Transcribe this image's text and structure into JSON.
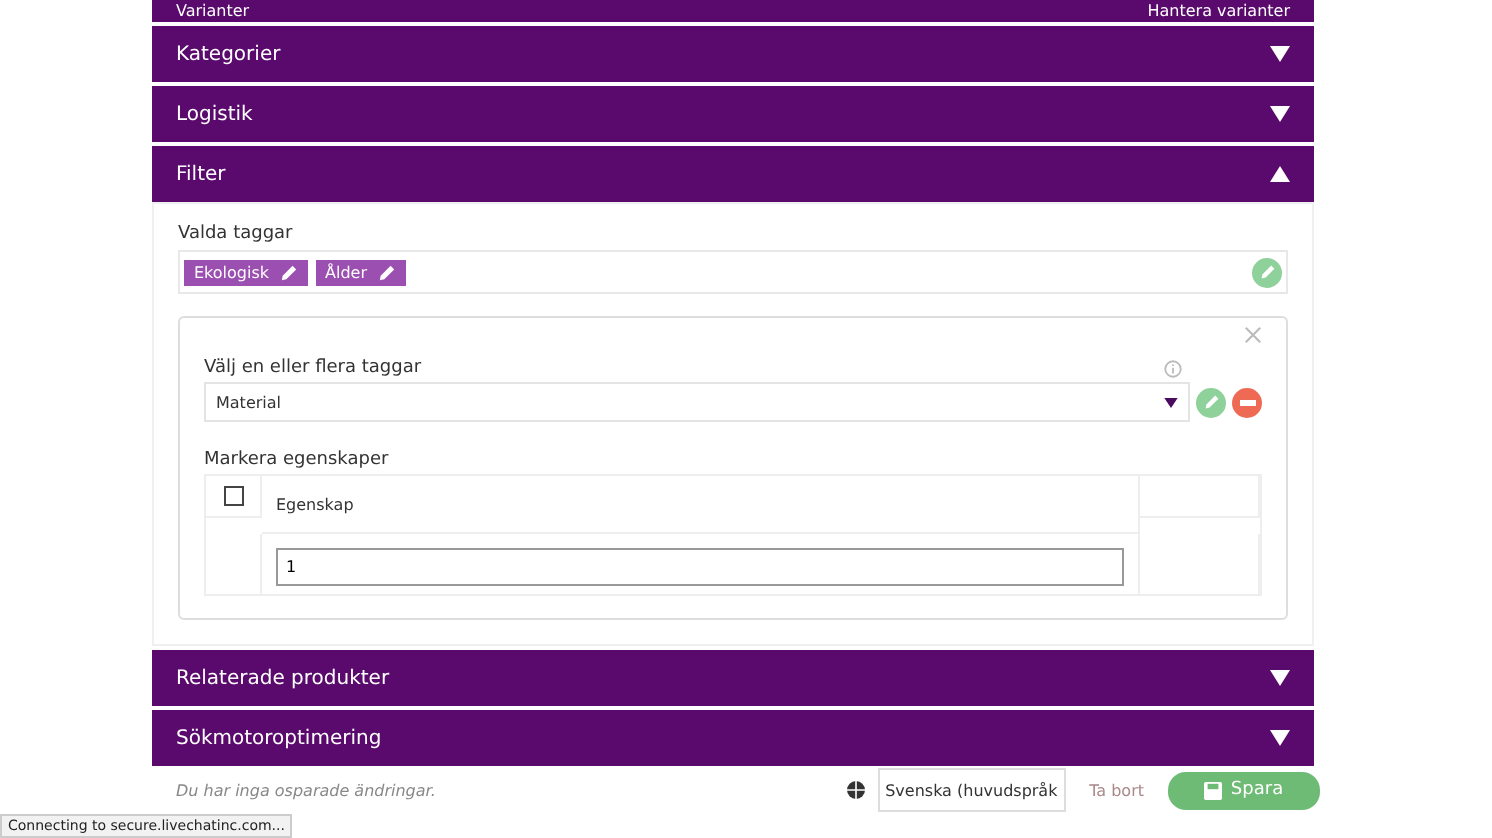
{
  "top_section": {
    "title": "Varianter",
    "action": "Hantera varianter"
  },
  "sections_before": [
    {
      "title": "Kategorier",
      "expanded": false
    },
    {
      "title": "Logistik",
      "expanded": false
    },
    {
      "title": "Filter",
      "expanded": true
    }
  ],
  "filter": {
    "selected_label": "Valda taggar",
    "tags": [
      "Ekologisk",
      "Ålder"
    ],
    "editor": {
      "select_label": "Välj en eller flera taggar",
      "select_value": "Material",
      "properties_label": "Markera egenskaper",
      "column_header": "Egenskap",
      "checked": false,
      "input_value": "1"
    }
  },
  "sections_after": [
    {
      "title": "Relaterade produkter",
      "expanded": false
    },
    {
      "title": "Sökmotoroptimering",
      "expanded": false
    }
  ],
  "footer": {
    "status": "Du har inga osparade ändringar.",
    "language": "Svenska (huvudspråk",
    "delete": "Ta bort",
    "save": "Spara"
  },
  "browser_status": "Connecting to secure.livechatinc.com..."
}
